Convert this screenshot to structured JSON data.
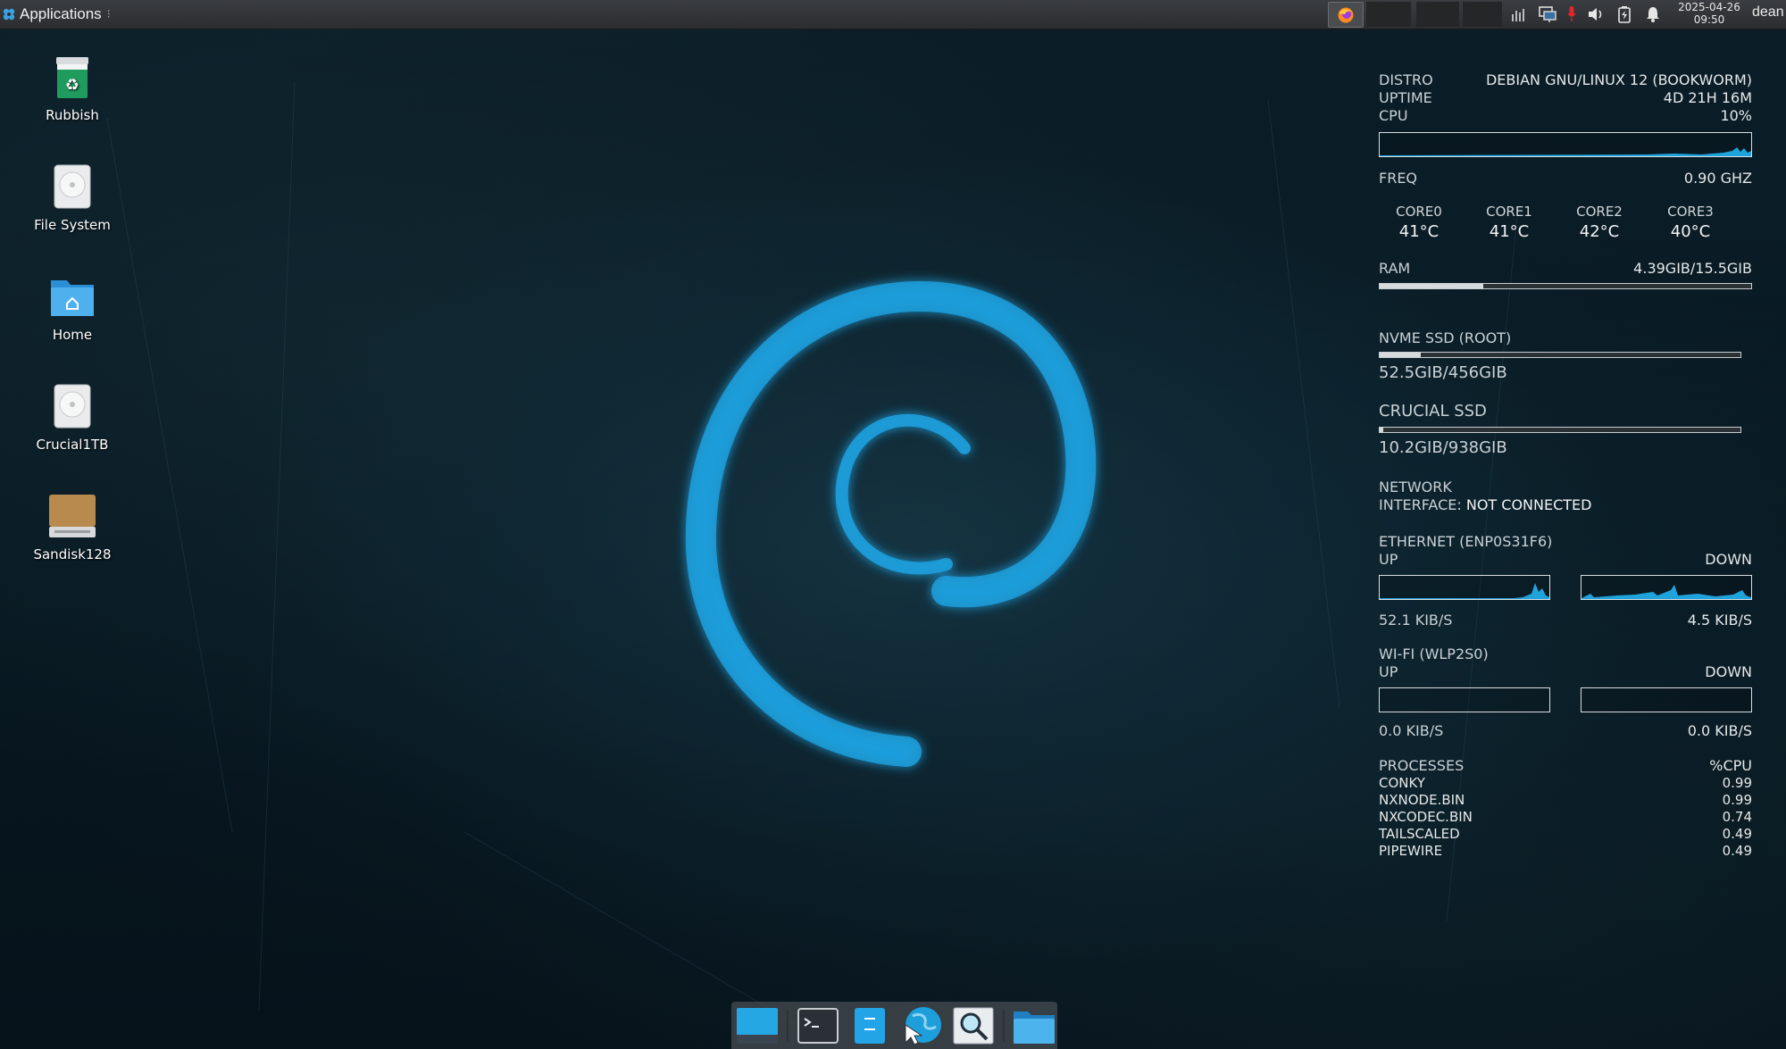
{
  "top_panel": {
    "applications_label": "Applications",
    "separator": "⁝",
    "clock": {
      "date": "2025-04-26",
      "time": "09:50"
    },
    "user": "dean",
    "tray_icons": [
      "network-monitor-icon",
      "network-icon",
      "microphone-icon",
      "volume-icon",
      "battery-icon",
      "notification-bell-icon"
    ],
    "task_icons": [
      "firefox-icon"
    ]
  },
  "desktop_icons": [
    {
      "label": "Rubbish",
      "icon": "trash-icon"
    },
    {
      "label": "File System",
      "icon": "drive-icon"
    },
    {
      "label": "Home",
      "icon": "home-folder-icon"
    },
    {
      "label": "Crucial1TB",
      "icon": "drive-icon"
    },
    {
      "label": "Sandisk128",
      "icon": "usb-drive-icon"
    }
  ],
  "conky": {
    "distro": {
      "label": "DISTRO",
      "value": "DEBIAN GNU/LINUX 12 (BOOKWORM)"
    },
    "uptime": {
      "label": "UPTIME",
      "value": "4D 21H 16M"
    },
    "cpu": {
      "label": "CPU",
      "value": "10%"
    },
    "freq": {
      "label": "FREQ",
      "value": "0.90 GHZ"
    },
    "cores": [
      {
        "name": "CORE0",
        "temp": "41°C"
      },
      {
        "name": "CORE1",
        "temp": "41°C"
      },
      {
        "name": "CORE2",
        "temp": "42°C"
      },
      {
        "name": "CORE3",
        "temp": "40°C"
      }
    ],
    "ram": {
      "label": "RAM",
      "value": "4.39GIB/15.5GIB",
      "fraction": 0.28
    },
    "nvme": {
      "label": "NVME SSD (ROOT)",
      "value": "52.5GIB/456GIB",
      "fraction": 0.115
    },
    "crucial": {
      "label": "CRUCIAL SSD",
      "value": "10.2GIB/938GIB",
      "fraction": 0.011
    },
    "network": {
      "label": "NETWORK",
      "interface_label": "INTERFACE:",
      "interface_value": "NOT CONNECTED"
    },
    "ethernet": {
      "label": "ETHERNET (ENP0S31F6)",
      "up_label": "UP",
      "down_label": "DOWN",
      "up_value": "52.1 KIB/S",
      "down_value": "4.5 KIB/S"
    },
    "wifi": {
      "label": "WI-FI (WLP2S0)",
      "up_label": "UP",
      "down_label": "DOWN",
      "up_value": "0.0 KIB/S",
      "down_value": "0.0 KIB/S"
    },
    "processes": {
      "label": "PROCESSES",
      "cpu_label": "%CPU",
      "list": [
        {
          "name": "CONKY",
          "cpu": "0.99"
        },
        {
          "name": "NXNODE.BIN",
          "cpu": "0.99"
        },
        {
          "name": "NXCODEC.BIN",
          "cpu": "0.74"
        },
        {
          "name": "TAILSCALED",
          "cpu": "0.49"
        },
        {
          "name": "PIPEWIRE",
          "cpu": "0.49"
        }
      ]
    }
  },
  "dock_items": [
    "desktop-icon",
    "terminal-icon",
    "file-manager-icon",
    "web-browser-icon",
    "app-finder-icon",
    "folder-icon"
  ],
  "colors": {
    "accent": "#1fa3dc",
    "swirl": "#1e9fdc",
    "panel": "#2f3134"
  }
}
